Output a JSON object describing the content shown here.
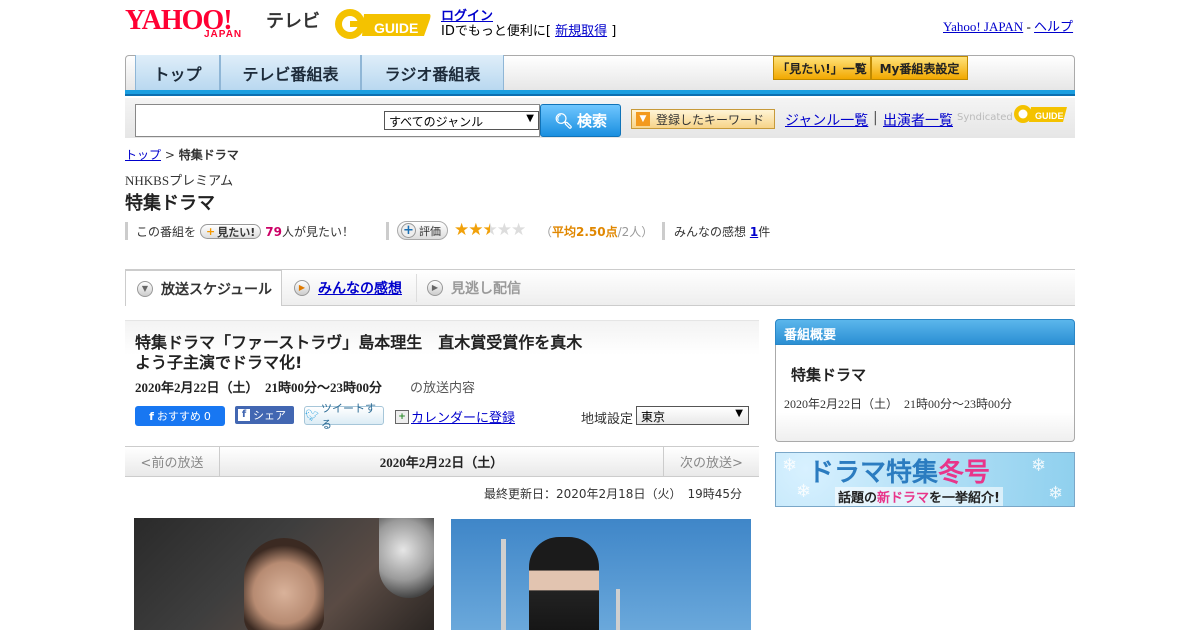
{
  "header": {
    "logo_main": "YAHOO!",
    "logo_sub": "JAPAN",
    "tv_label": "テレビ",
    "gguide_logo": "G GUIDE",
    "login_label": "ログイン",
    "id_prefix": "IDでもっと便利に[ ",
    "signup_label": "新規取得",
    "id_suffix": " ]",
    "yahoo_japan_link": "Yahoo! JAPAN",
    "dash": " - ",
    "help_link": "ヘルプ"
  },
  "nav": {
    "tabs": [
      {
        "label": "トップ"
      },
      {
        "label": "テレビ番組表"
      },
      {
        "label": "ラジオ番組表"
      }
    ],
    "mitai_list_label": "「見たい!」一覧",
    "my_bangumi_label": "My番組表設定"
  },
  "search": {
    "genre_selected": "すべてのジャンル",
    "search_button": "検索",
    "keyword_button": "登録したキーワード",
    "genre_list_link": "ジャンル一覧",
    "separator": "|",
    "cast_list_link": "出演者一覧",
    "syndicated": "Syndicated"
  },
  "breadcrumb": {
    "top": "トップ",
    "arrow": " > ",
    "current": "特集ドラマ"
  },
  "program": {
    "channel": "NHKBSプレミアム",
    "title": "特集ドラマ"
  },
  "stats": {
    "prefix": "この番組を",
    "mitai_pill": "見たい!",
    "mitai_count": "79",
    "mitai_suffix": "人が見たい！",
    "rate_button": "評価",
    "rating": 2.5,
    "avg_open": "（",
    "avg_label": "平均2.50点",
    "avg_suffix": "/2人）",
    "kanso_prefix": "みんなの感想",
    "kanso_count": "1",
    "kanso_suffix": "件"
  },
  "content_tabs": {
    "schedule": "放送スケジュール",
    "kanso": "みんなの感想",
    "minogashi": "見逃し配信"
  },
  "episode": {
    "title": "特集ドラマ「ファーストラヴ」島本理生　直木賞受賞作を真木よう子主演でドラマ化!",
    "date": "2020年2月22日（土）　21時00分～23時00分",
    "date_suffix": "の放送内容",
    "fb_recommend": "おすすめ",
    "fb_count": "0",
    "fb_share": "シェア",
    "tweet": "ツイートする",
    "calendar": "カレンダーに登録",
    "region_label": "地域設定",
    "region_selected": "東京"
  },
  "pager": {
    "prev": "<前の放送",
    "current_date": "2020年2月22日（土）",
    "next": "次の放送>"
  },
  "last_update": "最終更新日：2020年2月18日（火）　19時45分",
  "sidebar": {
    "header": "番組概要",
    "title": "特集ドラマ",
    "date": "2020年2月22日（土）　21時00分～23時00分"
  },
  "banner": {
    "title_main": "ドラマ特集",
    "title_season": "冬号",
    "sub_pre": "話題の",
    "sub_new": "新ドラマ",
    "sub_post": "を一挙紹介!"
  },
  "colors": {
    "yahoo_red": "#ff0033",
    "nav_blue": "#1b9ee0",
    "link": "#0000cc",
    "star": "#f1a10a",
    "mitai_count": "#cc0066"
  }
}
